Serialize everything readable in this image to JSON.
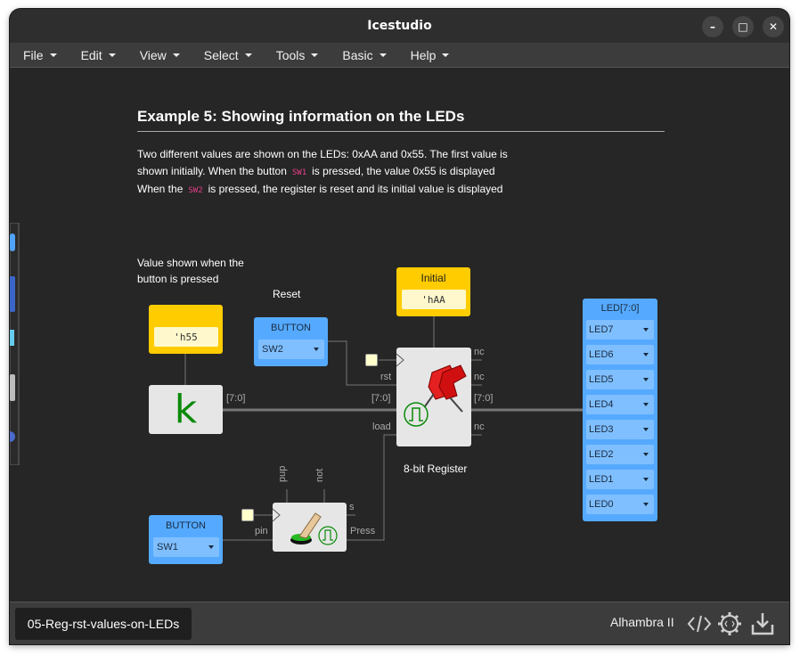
{
  "app": {
    "title": "Icestudio"
  },
  "window_controls": {
    "minimize": "–",
    "maximize": "□",
    "close": "✕"
  },
  "menu": [
    {
      "label": "File"
    },
    {
      "label": "Edit"
    },
    {
      "label": "View"
    },
    {
      "label": "Select"
    },
    {
      "label": "Tools"
    },
    {
      "label": "Basic"
    },
    {
      "label": "Help"
    }
  ],
  "doc": {
    "heading": "Example 5: Showing information on the LEDs",
    "line1": "Two different values are shown on the LEDs: 0xAA and 0x55. The first value is",
    "line2_a": "shown initially. When the button",
    "line2_code": "SW1",
    "line2_b": "is pressed, the value 0x55 is displayed",
    "line3_a": "When the",
    "line3_code": "SW2",
    "line3_b": "is pressed, the register is reset and its initial value is displayed"
  },
  "labels": {
    "value_shown_1": "Value shown when the",
    "value_shown_2": "button is pressed",
    "reset": "Reset",
    "register": "8-bit Register"
  },
  "blocks": {
    "const_h55": {
      "title": "",
      "value": "'h55"
    },
    "const_initial": {
      "title": "Initial",
      "value": "'hAA"
    },
    "k_block": {
      "text": "k"
    },
    "button_sw2": {
      "title": "BUTTON",
      "value": "SW2"
    },
    "button_sw1": {
      "title": "BUTTON",
      "value": "SW1"
    }
  },
  "ports": {
    "k_out": "[7:0]",
    "reg_in": "[7:0]",
    "reg_out": "[7:0]",
    "rst": "rst",
    "load": "load",
    "nc1": "nc",
    "nc2": "nc",
    "nc3": "nc",
    "pup": "pup",
    "not": "not",
    "s": "s",
    "pin": "pin",
    "press": "Press"
  },
  "leds": {
    "title": "LED[7:0]",
    "items": [
      "LED7",
      "LED6",
      "LED5",
      "LED4",
      "LED3",
      "LED2",
      "LED1",
      "LED0"
    ]
  },
  "status": {
    "file": "05-Reg-rst-values-on-LEDs",
    "board": "Alhambra II"
  },
  "icons": {
    "code": "code-icon",
    "settings": "gear-code-icon",
    "download": "download-icon"
  },
  "colors": {
    "const": "#ffcc00",
    "button": "#55aaff",
    "led": "#55aaff",
    "canvas": "#262626"
  }
}
